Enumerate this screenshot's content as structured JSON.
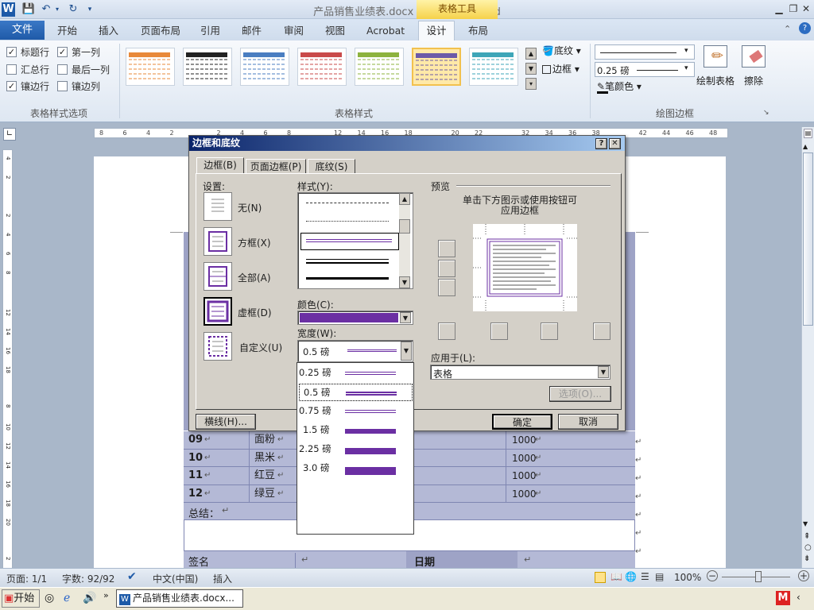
{
  "window": {
    "title": "产品销售业绩表.docx - Microsoft Word",
    "context_tab": "表格工具"
  },
  "tabs": {
    "file": "文件",
    "home": "开始",
    "insert": "插入",
    "layout": "页面布局",
    "references": "引用",
    "mail": "邮件",
    "review": "审阅",
    "view": "视图",
    "acrobat": "Acrobat",
    "design": "设计",
    "table_layout": "布局"
  },
  "ribbon": {
    "options": {
      "header_row": "标题行",
      "first_column": "第一列",
      "total_row": "汇总行",
      "last_column": "最后一列",
      "banded_rows": "镶边行",
      "banded_columns": "镶边列",
      "group": "表格样式选项"
    },
    "styles_group": "表格样式",
    "shading": "底纹",
    "borders": "边框",
    "pen_weight": "0.25 磅",
    "pen_color": "笔颜色",
    "draw_table": "绘制表格",
    "eraser": "擦除",
    "draw_borders_group": "绘图边框"
  },
  "ruler_top": [
    "8",
    "6",
    "4",
    "2",
    "",
    "2",
    "4",
    "6",
    "8",
    "",
    "12",
    "14",
    "16",
    "18",
    "",
    "20",
    "22",
    "",
    "32",
    "34",
    "36",
    "38",
    "",
    "42",
    "44",
    "46",
    "48"
  ],
  "ruler_left": [
    "4",
    "2",
    "",
    "2",
    "4",
    "6",
    "8",
    "",
    "12",
    "14",
    "16",
    "18",
    "",
    "8",
    "10",
    "12",
    "14",
    "16",
    "18",
    "20",
    "",
    "2"
  ],
  "document": {
    "rows": [
      {
        "no": "09",
        "name": "面粉",
        "qty": "1000"
      },
      {
        "no": "10",
        "name": "黑米",
        "qty": "1000"
      },
      {
        "no": "11",
        "name": "红豆",
        "qty": "1000"
      },
      {
        "no": "12",
        "name": "绿豆",
        "qty": "1000"
      }
    ],
    "summary": "总结：",
    "signature": "签名",
    "date": "日期",
    "mark": "↵"
  },
  "dialog": {
    "title": "边框和底纹",
    "help": "?",
    "close": "✕",
    "tabs": [
      "边框(B)",
      "页面边框(P)",
      "底纹(S)"
    ],
    "settings_label": "设置:",
    "settings": [
      "无(N)",
      "方框(X)",
      "全部(A)",
      "虚框(D)",
      "自定义(U)"
    ],
    "style_label": "样式(Y):",
    "color_label": "颜色(C):",
    "color_value": "#6b2fa3",
    "width_label": "宽度(W):",
    "width_value": "0.5 磅",
    "width_options": [
      "0.25 磅",
      "0.5 磅",
      "0.75 磅",
      "1.5 磅",
      "2.25 磅",
      "3.0 磅"
    ],
    "preview_label": "预览",
    "preview_hint_1": "单击下方图示或使用按钮可",
    "preview_hint_2": "应用边框",
    "apply_label": "应用于(L):",
    "apply_value": "表格",
    "options_btn": "选项(O)...",
    "hline_btn": "横线(H)...",
    "ok": "确定",
    "cancel": "取消"
  },
  "status": {
    "page": "页面: 1/1",
    "words": "字数: 92/92",
    "lang": "中文(中国)",
    "mode": "插入",
    "zoom": "100%"
  },
  "taskbar": {
    "start": "开始",
    "task": "产品销售业绩表.docx..."
  }
}
